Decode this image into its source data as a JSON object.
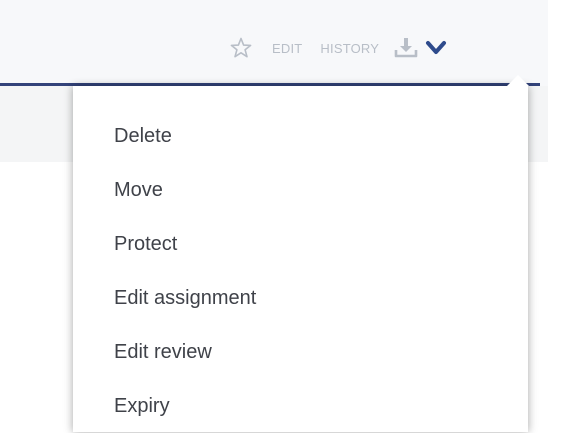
{
  "toolbar": {
    "star_icon": "star-outline-icon",
    "edit_label": "EDIT",
    "history_label": "HISTORY",
    "download_icon": "download-icon",
    "chevron_icon": "chevron-down-icon"
  },
  "dropdown": {
    "items": [
      {
        "label": "Delete"
      },
      {
        "label": "Move"
      },
      {
        "label": "Protect"
      },
      {
        "label": "Edit assignment"
      },
      {
        "label": "Edit review"
      },
      {
        "label": "Expiry"
      }
    ]
  },
  "colors": {
    "rule": "#33437a",
    "toolbar_text": "#b8bec7",
    "chevron": "#2e4b8c",
    "menu_text": "#3f4249"
  }
}
